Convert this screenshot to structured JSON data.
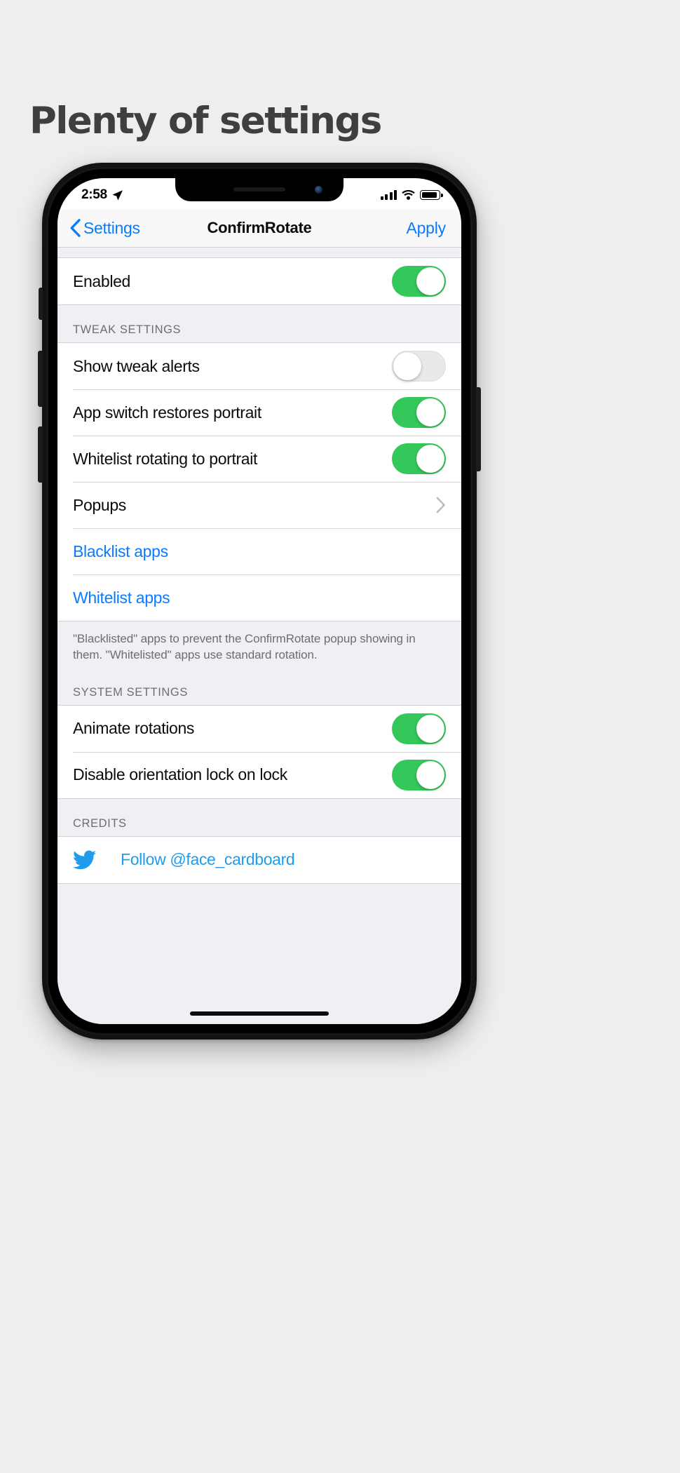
{
  "headline": "Plenty of settings",
  "phone": {
    "status_bar": {
      "time": "2:58",
      "location_icon": "location-arrow-icon",
      "signal_icon": "cellular-bars-icon",
      "wifi_icon": "wifi-icon",
      "battery_icon": "battery-full-icon"
    },
    "nav_bar": {
      "back_label": "Settings",
      "back_icon": "chevron-left-icon",
      "title": "ConfirmRotate",
      "apply_label": "Apply"
    }
  },
  "settings": {
    "enabled_group": {
      "rows": [
        {
          "label": "Enabled",
          "type": "toggle",
          "value": "on"
        }
      ]
    },
    "tweak_section": {
      "header": "TWEAK SETTINGS",
      "rows": [
        {
          "label": "Show tweak alerts",
          "type": "toggle",
          "value": "off"
        },
        {
          "label": "App switch restores portrait",
          "type": "toggle",
          "value": "on"
        },
        {
          "label": "Whitelist rotating to portrait",
          "type": "toggle",
          "value": "on"
        },
        {
          "label": "Popups",
          "type": "disclosure",
          "icon": "chevron-right-icon"
        },
        {
          "label": "Blacklist apps",
          "type": "link"
        },
        {
          "label": "Whitelist apps",
          "type": "link"
        }
      ],
      "footer": "\"Blacklisted\" apps to prevent the ConfirmRotate popup showing in them. \"Whitelisted\" apps use standard rotation."
    },
    "system_section": {
      "header": "SYSTEM SETTINGS",
      "rows": [
        {
          "label": "Animate rotations",
          "type": "toggle",
          "value": "on"
        },
        {
          "label": "Disable orientation lock on lock",
          "type": "toggle",
          "value": "on"
        }
      ]
    },
    "credits_section": {
      "header": "CREDITS",
      "rows": [
        {
          "label": "Follow @face_cardboard",
          "type": "link",
          "icon": "twitter-icon"
        }
      ]
    }
  },
  "colors": {
    "accent_blue": "#0a7bff",
    "toggle_green": "#34c85a",
    "twitter_blue": "#1f9ceb",
    "background": "#efeff4",
    "page_background": "#eeeeee"
  }
}
